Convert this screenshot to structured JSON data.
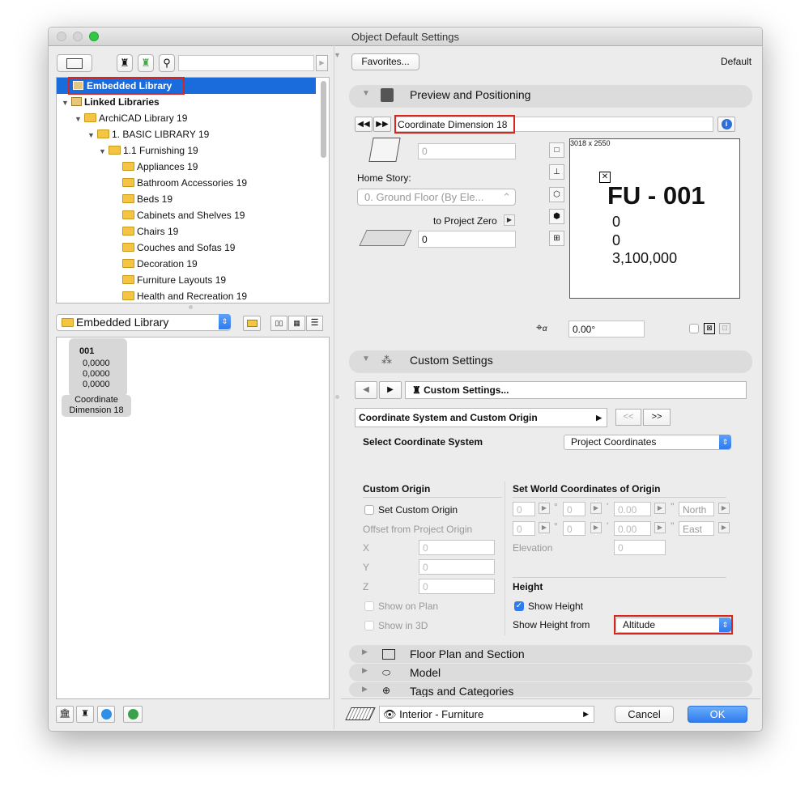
{
  "window": {
    "title": "Object Default Settings"
  },
  "left_toolbar": {
    "search_placeholder": ""
  },
  "tree": {
    "embedded": "Embedded Library",
    "linked": "Linked Libraries",
    "archicad": "ArchiCAD Library 19",
    "basic": "1. BASIC LIBRARY 19",
    "furnishing": "1.1 Furnishing 19",
    "items": [
      "Appliances 19",
      "Bathroom Accessories 19",
      "Beds 19",
      "Cabinets and Shelves 19",
      "Chairs 19",
      "Couches and Sofas 19",
      "Decoration 19",
      "Furniture Layouts 19",
      "Health and Recreation 19"
    ]
  },
  "library_popup": {
    "label": "Embedded Library"
  },
  "thumb": {
    "l1": "001",
    "l2": "0,0000",
    "l3": "0,0000",
    "l4": "0,0000",
    "name1": "Coordinate",
    "name2": "Dimension 18"
  },
  "top": {
    "favorites": "Favorites...",
    "default": "Default"
  },
  "preview_section": {
    "title": "Preview and Positioning",
    "object_name": "Coordinate Dimension 18",
    "height_value": "0",
    "home_story_label": "Home Story:",
    "home_story_value": "0. Ground Floor (By Ele...",
    "to_project_zero": "to Project Zero",
    "elevation_value": "0",
    "preview_size": "3018 x 2550",
    "preview_title": "FU - 001",
    "preview_v1": "0",
    "preview_v2": "0",
    "preview_v3": "3,100,000",
    "angle": "0.00°"
  },
  "custom_section": {
    "title": "Custom Settings",
    "nav_label": "Custom Settings...",
    "page_popup": "Coordinate System and Custom Origin",
    "prev": "<<",
    "next": ">>",
    "select_cs_label": "Select Coordinate System",
    "select_cs_value": "Project Coordinates",
    "custom_origin": "Custom Origin",
    "set_custom_origin": "Set Custom Origin",
    "offset_label": "Offset from Project Origin",
    "x": "X",
    "y": "Y",
    "z": "Z",
    "x_val": "0",
    "y_val": "0",
    "z_val": "0",
    "show_on_plan": "Show on Plan",
    "show_in_3d": "Show in 3D",
    "world_coords": "Set World Coordinates of Origin",
    "deg": "°",
    "min": "'",
    "sec": "''",
    "lat_d": "0",
    "lat_m": "0",
    "lat_s": "0.00",
    "north": "North",
    "lon_d": "0",
    "lon_m": "0",
    "lon_s": "0.00",
    "east": "East",
    "elevation_label": "Elevation",
    "elevation_val": "0",
    "height_hdr": "Height",
    "show_height": "Show Height",
    "show_height_from": "Show Height from",
    "show_height_from_value": "Altitude"
  },
  "collapsed_sections": [
    "Floor Plan and Section",
    "Model",
    "Tags and Categories"
  ],
  "bottom": {
    "layer": "Interior - Furniture",
    "cancel": "Cancel",
    "ok": "OK"
  },
  "colors": {
    "accent": "#2f7cf0",
    "highlight": "#d9261c",
    "selection": "#1a6bdb"
  }
}
